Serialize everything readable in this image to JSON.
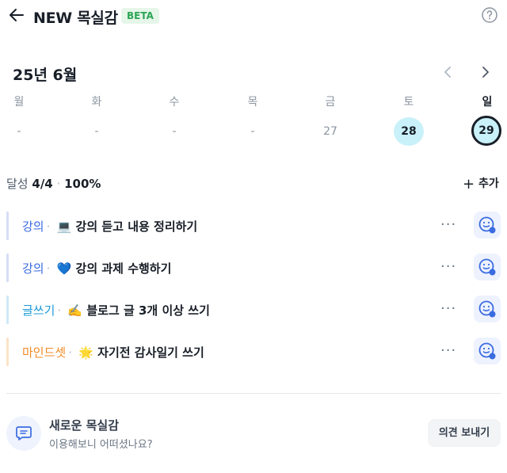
{
  "header": {
    "title": "NEW 목실감",
    "badge": "BETA"
  },
  "calendar": {
    "month_label": "25년 6월",
    "weekdays": [
      "월",
      "화",
      "수",
      "목",
      "금",
      "토",
      "일"
    ],
    "days": [
      "-",
      "-",
      "-",
      "-",
      "27",
      "28",
      "29"
    ],
    "selected_day": "29",
    "highlight_day": "28"
  },
  "summary": {
    "label": "달성",
    "count": "4/4",
    "sep": "·",
    "percent": "100%",
    "add_label": "추가"
  },
  "tasks": [
    {
      "category": "강의",
      "emoji": "💻",
      "title": "강의 듣고 내용 정리하기",
      "color": "#3a6be0",
      "bar": "#d6def5"
    },
    {
      "category": "강의",
      "emoji": "💙",
      "title": "강의 과제 수행하기",
      "color": "#3a6be0",
      "bar": "#d6def5"
    },
    {
      "category": "글쓰기",
      "emoji": "✍️",
      "title": "블로그 글 3개 이상 쓰기",
      "color": "#1a9bd7",
      "bar": "#cfe9f6"
    },
    {
      "category": "마인드셋",
      "emoji": "🌟",
      "title": "자기전 감사일기 쓰기",
      "color": "#f08a24",
      "bar": "#fbe3c8"
    }
  ],
  "task_more": "···",
  "feedback": {
    "title": "새로운 목실감",
    "subtitle": "이용해보니 어떠셨나요?",
    "button": "의견 보내기"
  },
  "colors": {
    "accent_blue": "#3a6be0",
    "highlight": "#c9f1f9",
    "badge_green": "#2aa655"
  }
}
